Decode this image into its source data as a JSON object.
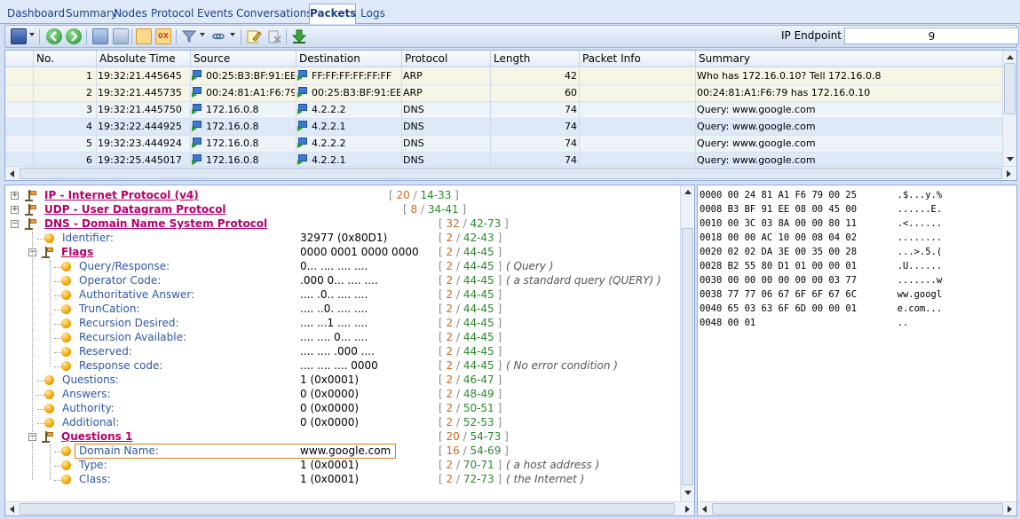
{
  "tabs": [
    {
      "label": "Dashboard",
      "active": false
    },
    {
      "label": "Summary",
      "active": false
    },
    {
      "label": "Nodes",
      "active": false
    },
    {
      "label": "Protocol",
      "active": false
    },
    {
      "label": "Events",
      "active": false
    },
    {
      "label": "Conversations",
      "active": false
    },
    {
      "label": "Packets",
      "active": true
    },
    {
      "label": "Logs",
      "active": false
    }
  ],
  "toolbar": {
    "ip_endpoint_label": "IP Endpoint",
    "ip_endpoint_value": "9",
    "icons": [
      "save-icon",
      "back-icon",
      "forward-icon",
      "panel-layout-icon",
      "tree-view-icon",
      "hex-view-icon",
      "filter-icon",
      "link-icon",
      "edit-icon",
      "delete-icon",
      "download-icon"
    ]
  },
  "packets": {
    "columns": [
      "No.",
      "Absolute Time",
      "Source",
      "Destination",
      "Protocol",
      "Length",
      "Packet Info",
      "Summary"
    ],
    "rows": [
      {
        "no": "1",
        "time": "19:32:21.445645",
        "src": "00:25:B3:BF:91:EE",
        "dst": "FF:FF:FF:FF:FF:FF",
        "proto": "ARP",
        "len": "42",
        "info": "",
        "summary": "Who has 172.16.0.10? Tell 172.16.0.8"
      },
      {
        "no": "2",
        "time": "19:32:21.445735",
        "src": "00:24:81:A1:F6:79",
        "dst": "00:25:B3:BF:91:EE",
        "proto": "ARP",
        "len": "60",
        "info": "",
        "summary": "00:24:81:A1:F6:79 has 172.16.0.10"
      },
      {
        "no": "3",
        "time": "19:32:21.445750",
        "src": "172.16.0.8",
        "dst": "4.2.2.2",
        "proto": "DNS",
        "len": "74",
        "info": "",
        "summary": "Query: www.google.com"
      },
      {
        "no": "4",
        "time": "19:32:22.444925",
        "src": "172.16.0.8",
        "dst": "4.2.2.1",
        "proto": "DNS",
        "len": "74",
        "info": "",
        "summary": "Query: www.google.com"
      },
      {
        "no": "5",
        "time": "19:32:23.444924",
        "src": "172.16.0.8",
        "dst": "4.2.2.2",
        "proto": "DNS",
        "len": "74",
        "info": "",
        "summary": "Query: www.google.com"
      },
      {
        "no": "6",
        "time": "19:32:25.445017",
        "src": "172.16.0.8",
        "dst": "4.2.2.1",
        "proto": "DNS",
        "len": "74",
        "info": "",
        "summary": "Query: www.google.com"
      }
    ]
  },
  "tree": [
    {
      "kind": "proto",
      "level": 0,
      "expanded": false,
      "label": "IP - Internet Protocol (v4)",
      "value": "",
      "r1": "20",
      "r2": "14-33",
      "desc": ""
    },
    {
      "kind": "proto",
      "level": 0,
      "expanded": false,
      "label": "UDP - User Datagram Protocol",
      "value": "",
      "r1": "8",
      "r2": "34-41",
      "desc": ""
    },
    {
      "kind": "proto",
      "level": 0,
      "expanded": true,
      "label": "DNS - Domain Name System Protocol",
      "value": "",
      "r1": "32",
      "r2": "42-73",
      "desc": ""
    },
    {
      "kind": "field",
      "level": 1,
      "label": "Identifier:",
      "value": "32977 (0x80D1)",
      "r1": "2",
      "r2": "42-43",
      "desc": ""
    },
    {
      "kind": "group",
      "level": 1,
      "expanded": true,
      "label": "Flags",
      "value": "0000 0001 0000 0000",
      "r1": "2",
      "r2": "44-45",
      "desc": ""
    },
    {
      "kind": "field",
      "level": 2,
      "label": "Query/Response:",
      "value": "0... .... .... ....",
      "r1": "2",
      "r2": "44-45",
      "desc": "( Query )"
    },
    {
      "kind": "field",
      "level": 2,
      "label": "Operator Code:",
      "value": ".000 0... .... ....",
      "r1": "2",
      "r2": "44-45",
      "desc": "( a standard query (QUERY) )"
    },
    {
      "kind": "field",
      "level": 2,
      "label": "Authoritative Answer:",
      "value": ".... .0.. .... ....",
      "r1": "2",
      "r2": "44-45",
      "desc": ""
    },
    {
      "kind": "field",
      "level": 2,
      "label": "TrunCation:",
      "value": ".... ..0. .... ....",
      "r1": "2",
      "r2": "44-45",
      "desc": ""
    },
    {
      "kind": "field",
      "level": 2,
      "label": "Recursion Desired:",
      "value": ".... ...1 .... ....",
      "r1": "2",
      "r2": "44-45",
      "desc": ""
    },
    {
      "kind": "field",
      "level": 2,
      "label": "Recursion Available:",
      "value": ".... .... 0... ....",
      "r1": "2",
      "r2": "44-45",
      "desc": ""
    },
    {
      "kind": "field",
      "level": 2,
      "label": "Reserved:",
      "value": ".... .... .000 ....",
      "r1": "2",
      "r2": "44-45",
      "desc": ""
    },
    {
      "kind": "field",
      "level": 2,
      "label": "Response code:",
      "value": ".... .... .... 0000",
      "r1": "2",
      "r2": "44-45",
      "desc": "( No error condition )"
    },
    {
      "kind": "field",
      "level": 1,
      "label": "Questions:",
      "value": "1 (0x0001)",
      "r1": "2",
      "r2": "46-47",
      "desc": ""
    },
    {
      "kind": "field",
      "level": 1,
      "label": "Answers:",
      "value": "0 (0x0000)",
      "r1": "2",
      "r2": "48-49",
      "desc": ""
    },
    {
      "kind": "field",
      "level": 1,
      "label": "Authority:",
      "value": "0 (0x0000)",
      "r1": "2",
      "r2": "50-51",
      "desc": ""
    },
    {
      "kind": "field",
      "level": 1,
      "label": "Additional:",
      "value": "0 (0x0000)",
      "r1": "2",
      "r2": "52-53",
      "desc": ""
    },
    {
      "kind": "group",
      "level": 1,
      "expanded": true,
      "label": "Questions 1",
      "value": "",
      "r1": "20",
      "r2": "54-73",
      "desc": ""
    },
    {
      "kind": "field",
      "level": 2,
      "label": "Domain Name:",
      "value": "www.google.com",
      "r1": "16",
      "r2": "54-69",
      "desc": "",
      "selected": true
    },
    {
      "kind": "field",
      "level": 2,
      "label": "Type:",
      "value": "1 (0x0001)",
      "r1": "2",
      "r2": "70-71",
      "desc": "( a host address )"
    },
    {
      "kind": "field",
      "level": 2,
      "label": "Class:",
      "value": "1 (0x0001)",
      "r1": "2",
      "r2": "72-73",
      "desc": "( the Internet )"
    }
  ],
  "hex": [
    {
      "off": "0000",
      "bytes": "00 24 81 A1 F6 79 00 25",
      "ascii": ".$...y.%"
    },
    {
      "off": "0008",
      "bytes": "B3 BF 91 EE 08 00 45 00",
      "ascii": "......E."
    },
    {
      "off": "0010",
      "bytes": "00 3C 03 8A 00 00 80 11",
      "ascii": ".<......"
    },
    {
      "off": "0018",
      "bytes": "00 00 AC 10 00 08 04 02",
      "ascii": "........"
    },
    {
      "off": "0020",
      "bytes": "02 02 DA 3E 00 35 00 28",
      "ascii": "...>.5.("
    },
    {
      "off": "0028",
      "bytes": "B2 55 80 D1 01 00 00 01",
      "ascii": ".U......"
    },
    {
      "off": "0030",
      "bytes": "00 00 00 00 00 00 03 77",
      "ascii": ".......w"
    },
    {
      "off": "0038",
      "bytes": "77 77 06 67 6F 6F 67 6C",
      "ascii": "ww.googl"
    },
    {
      "off": "0040",
      "bytes": "65 03 63 6F 6D 00 00 01",
      "ascii": "e.com..."
    },
    {
      "off": "0048",
      "bytes": "00 01",
      "ascii": ".."
    }
  ]
}
